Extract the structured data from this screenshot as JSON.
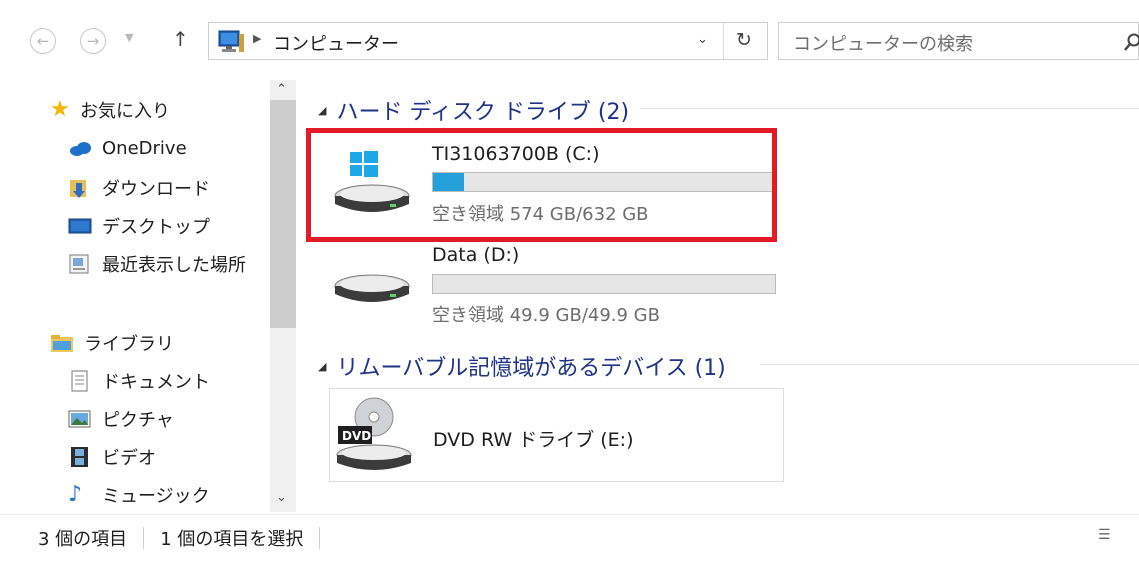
{
  "address": {
    "path": "コンピューター"
  },
  "search": {
    "placeholder": "コンピューターの検索"
  },
  "sidebar": {
    "favorites": {
      "label": "お気に入り",
      "items": [
        "OneDrive",
        "ダウンロード",
        "デスクトップ",
        "最近表示した場所"
      ]
    },
    "libraries": {
      "label": "ライブラリ",
      "items": [
        "ドキュメント",
        "ピクチャ",
        "ビデオ",
        "ミュージック"
      ]
    }
  },
  "groups": {
    "hdd": {
      "title": "ハード ディスク ドライブ (2)",
      "drives": [
        {
          "name": "TI31063700B (C:)",
          "free": "空き領域 574 GB/632 GB",
          "used_fraction": 0.092
        },
        {
          "name": "Data (D:)",
          "free": "空き領域 49.9 GB/49.9 GB",
          "used_fraction": 0.0
        }
      ]
    },
    "removable": {
      "title": "リムーバブル記憶域があるデバイス (1)",
      "drives": [
        {
          "name": "DVD RW ドライブ (E:)",
          "badge": "DVD"
        }
      ]
    }
  },
  "status": {
    "count": "3 個の項目",
    "selected": "1 個の項目を選択"
  },
  "colors": {
    "highlight": "#e21b26",
    "bar_fill": "#26a0da",
    "header_text": "#1e3287"
  }
}
